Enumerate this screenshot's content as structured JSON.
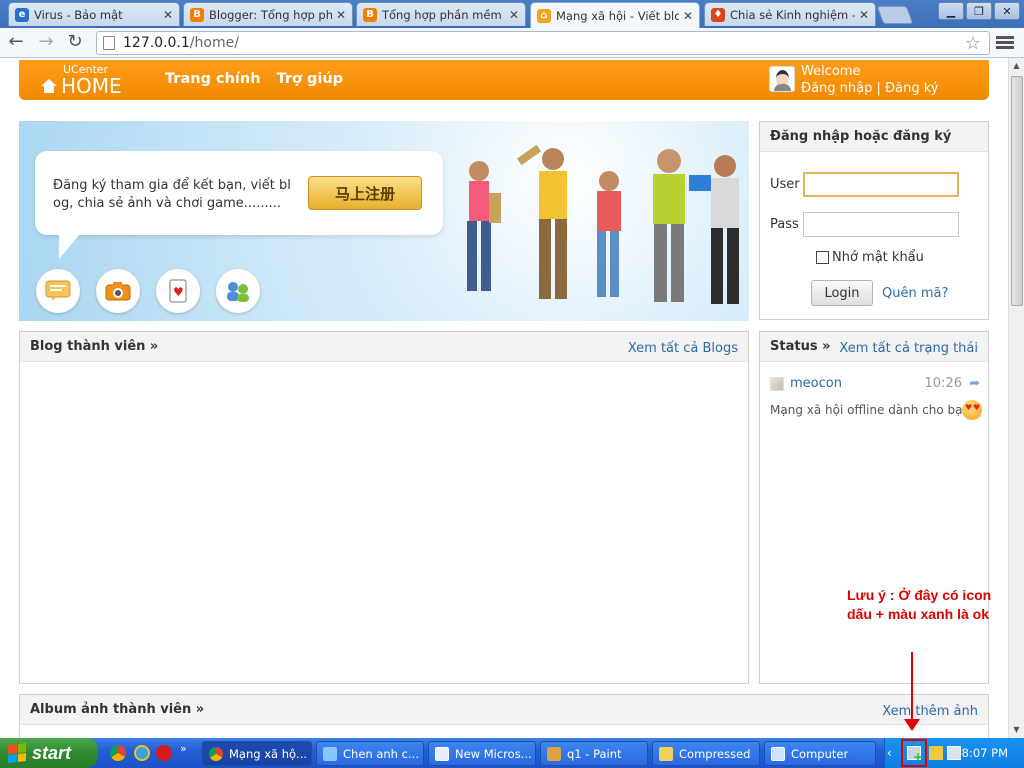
{
  "browser": {
    "tabs": [
      {
        "title": "Virus - Bảo mật",
        "icon": "ie-globe-icon",
        "color": "#2a6fc9"
      },
      {
        "title": "Blogger: Tổng hợp phần",
        "icon": "blogger-icon",
        "color": "#f57d00"
      },
      {
        "title": "Tổng hợp phần mềm hay",
        "icon": "blogger-icon",
        "color": "#f57d00"
      },
      {
        "title": "Mạng xã hội - Viết blog -",
        "icon": "home-icon",
        "color": "#f7a21c"
      },
      {
        "title": "Chia sẻ Kinh nghiệm - Thu",
        "icon": "shield-icon",
        "color": "#d9441d"
      }
    ],
    "url_host": "127.0.0.1",
    "url_path": "/home/"
  },
  "site": {
    "logo_small": "UCenter",
    "logo_big": "HOME",
    "nav": [
      "Trang chính",
      "Trợ giúp"
    ],
    "welcome": "Welcome",
    "login_link": "Đăng nhập",
    "separator": "|",
    "register_link": "Đăng ký",
    "accent": "#f7930f"
  },
  "banner": {
    "text": "Đăng ký tham gia để kết bạn, viết blog, chia sẻ ảnh và chơi game.........",
    "button": "马上注册"
  },
  "login": {
    "title": "Đăng nhập hoặc đăng ký",
    "user_label": "User",
    "pass_label": "Pass",
    "user_value": "",
    "pass_value": "",
    "remember": "Nhớ mật khẩu",
    "button": "Login",
    "forgot": "Quên mã?"
  },
  "blog": {
    "title": "Blog thành viên »",
    "more": "Xem tất cả Blogs"
  },
  "status": {
    "title": "Status »",
    "more": "Xem tất cả trạng thái",
    "user": "meocon",
    "time": "10:26",
    "text": "Mạng xã hội offline dành cho bạn"
  },
  "album": {
    "title": "Album ảnh thành viên »",
    "more": "Xem thêm ảnh"
  },
  "annotation": "Lưu ý : Ở đây có icon dấu + màu xanh là ok",
  "taskbar": {
    "start": "start",
    "buttons": [
      {
        "label": "Mạng xã hộ...",
        "icon": "chrome-icon"
      },
      {
        "label": "Chen anh c...",
        "icon": "editor-icon"
      },
      {
        "label": "New Micros...",
        "icon": "word-icon"
      },
      {
        "label": "q1 - Paint",
        "icon": "paint-icon"
      },
      {
        "label": "Compressed",
        "icon": "folder-icon"
      },
      {
        "label": "Computer",
        "icon": "computer-icon"
      }
    ],
    "clock": "8:07 PM"
  }
}
